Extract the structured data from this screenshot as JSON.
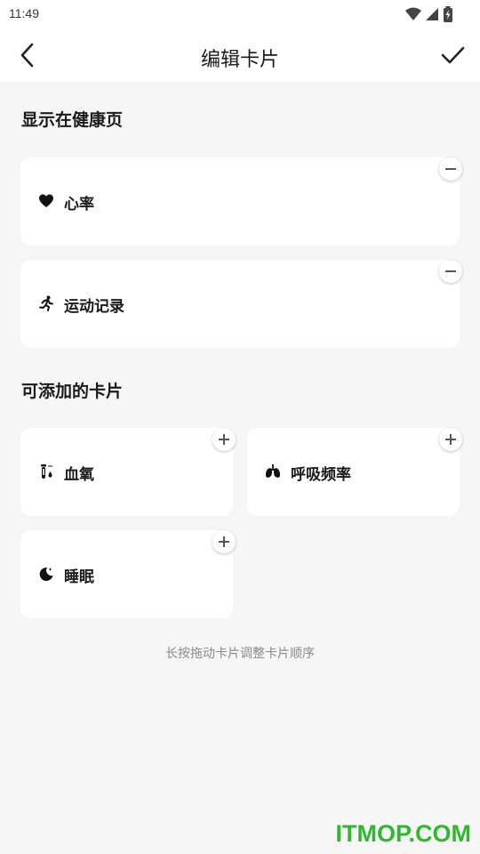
{
  "status_bar": {
    "time": "11:49",
    "icons": [
      "wifi-icon",
      "signal-icon",
      "battery-charging-icon"
    ]
  },
  "header": {
    "title": "编辑卡片",
    "back_icon": "chevron-left-icon",
    "confirm_icon": "check-icon"
  },
  "sections": {
    "shown": {
      "title": "显示在健康页"
    },
    "available": {
      "title": "可添加的卡片"
    }
  },
  "shown_cards": [
    {
      "label": "心率",
      "icon": "heart-icon",
      "action": "remove"
    },
    {
      "label": "运动记录",
      "icon": "running-icon",
      "action": "remove"
    }
  ],
  "available_cards": [
    {
      "label": "血氧",
      "icon": "blood-oxygen-icon",
      "action": "add"
    },
    {
      "label": "呼吸频率",
      "icon": "lungs-icon",
      "action": "add"
    },
    {
      "label": "睡眠",
      "icon": "moon-icon",
      "action": "add"
    }
  ],
  "footer": {
    "hint": "长按拖动卡片调整卡片顺序"
  },
  "watermark": {
    "text": "ITMOP.COM"
  },
  "colors": {
    "background": "#f6f6f6",
    "card": "#ffffff",
    "watermark": "#2fb82f",
    "hint": "#8a8a8a"
  }
}
